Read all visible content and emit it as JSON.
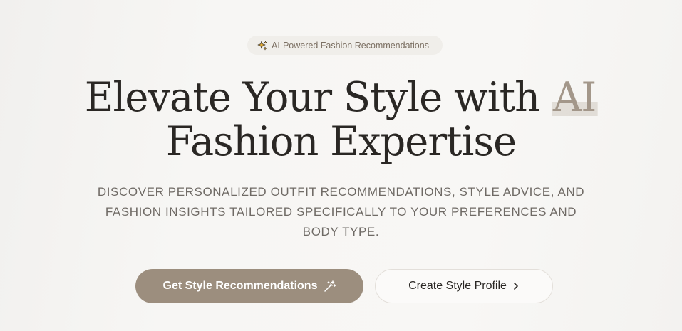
{
  "badge": {
    "icon": "sparkles-icon",
    "text": "AI-Powered Fashion Recommendations"
  },
  "headline": {
    "line1_prefix": "Elevate Your Style with",
    "line1_accent": "AI",
    "line2": "Fashion Expertise"
  },
  "subtitle": "Discover personalized outfit recommendations, style advice, and fashion insights tailored specifically to your preferences and body type.",
  "buttons": {
    "primary_label": "Get Style Recommendations",
    "primary_icon": "magic-wand-icon",
    "secondary_label": "Create Style Profile",
    "secondary_icon": "chevron-right-icon"
  },
  "colors": {
    "accent": "#9c8e7e",
    "accent_text": "#a3978a",
    "text_dark": "#2a2724",
    "text_muted": "#6f6a65",
    "badge_bg": "#f0eeea"
  }
}
